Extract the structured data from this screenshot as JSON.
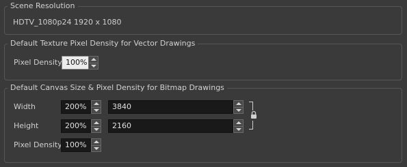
{
  "scene_resolution": {
    "title": "Scene Resolution",
    "value": "HDTV_1080p24  1920 x 1080"
  },
  "vector_group": {
    "title": "Default Texture Pixel Density for Vector Drawings",
    "pixel_density_label": "Pixel Density",
    "pixel_density_value": "100%"
  },
  "bitmap_group": {
    "title": "Default Canvas Size & Pixel Density for Bitmap Drawings",
    "width_label": "Width",
    "width_percent": "200%",
    "width_value": "3840",
    "height_label": "Height",
    "height_percent": "200%",
    "height_value": "2160",
    "pixel_density_label": "Pixel Density",
    "pixel_density_value": "100%",
    "lock_icon": "lock-icon"
  }
}
